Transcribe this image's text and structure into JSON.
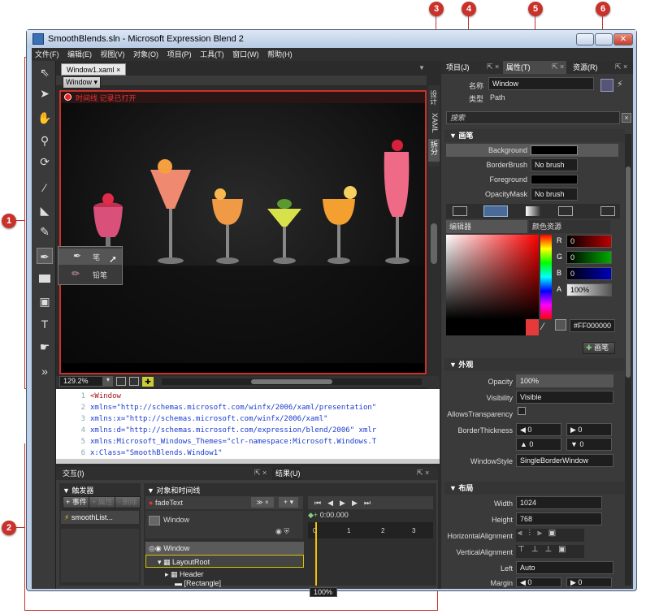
{
  "callouts": [
    "1",
    "2",
    "3",
    "4",
    "5",
    "6"
  ],
  "window": {
    "title": "SmoothBlends.sln - Microsoft Expression Blend 2",
    "menu": [
      "文件(F)",
      "编辑(E)",
      "视图(V)",
      "对象(O)",
      "项目(P)",
      "工具(T)",
      "窗口(W)",
      "帮助(H)"
    ]
  },
  "document": {
    "tab": "Window1.xaml",
    "tab_close": "×",
    "scope": "Window",
    "recording": "时间线 记录已打开",
    "zoom": "129.2%",
    "side_tabs": [
      "设计",
      "XAML",
      "拆分"
    ]
  },
  "tool_flyout": {
    "pen": "笔",
    "pencil": "铅笔"
  },
  "xaml": {
    "lines": [
      {
        "n": "1",
        "text": "<Window"
      },
      {
        "n": "2",
        "text": "    xmlns=\"http://schemas.microsoft.com/winfx/2006/xaml/presentation\""
      },
      {
        "n": "3",
        "text": "    xmlns:x=\"http://schemas.microsoft.com/winfx/2006/xaml\""
      },
      {
        "n": "4",
        "text": "    xmlns:d=\"http://schemas.microsoft.com/expression/blend/2006\" xmlr"
      },
      {
        "n": "5",
        "text": "    xmlns:Microsoft_Windows_Themes=\"clr-namespace:Microsoft.Windows.T"
      },
      {
        "n": "6",
        "text": "    x:Class=\"SmoothBlends.Window1\""
      }
    ]
  },
  "interaction": {
    "tab": "交互(I)",
    "triggers_title": "触发器",
    "add_event": "+ 事件",
    "add_property": "+ 属性",
    "remove": "- 删除",
    "trigger_item": "smoothList...",
    "objects_title": "对象和时间线",
    "storyboard": "fadeText",
    "time": "0:00.000",
    "window_label": "Window",
    "ticks": [
      "0",
      "1",
      "2",
      "3"
    ],
    "tree": [
      "Window",
      "LayoutRoot",
      "Header",
      "[Rectangle]"
    ],
    "zoom": "100%"
  },
  "results_tab": "结果(U)",
  "right_tabs": {
    "project": "项目(J)",
    "properties": "属性(T)",
    "resources": "资源(R)"
  },
  "properties": {
    "name_label": "名称",
    "name_value": "Window",
    "type_label": "类型",
    "type_value": "Path",
    "search": "搜索",
    "brushes_title": "画笔",
    "brushes": [
      {
        "name": "Background",
        "value": ""
      },
      {
        "name": "BorderBrush",
        "value": "No brush"
      },
      {
        "name": "Foreground",
        "value": ""
      },
      {
        "name": "OpacityMask",
        "value": "No brush"
      }
    ],
    "editor_tab": "编辑器",
    "color_res_tab": "颜色资源",
    "rgba": [
      {
        "k": "R",
        "v": "0"
      },
      {
        "k": "G",
        "v": "0"
      },
      {
        "k": "B",
        "v": "0"
      },
      {
        "k": "A",
        "v": "100%"
      }
    ],
    "hex": "#FF000000",
    "brush_btn": "画笔",
    "appearance_title": "外观",
    "appearance": [
      {
        "name": "Opacity",
        "value": "100%"
      },
      {
        "name": "Visibility",
        "value": "Visible"
      },
      {
        "name": "AllowsTransparency",
        "value": ""
      },
      {
        "name": "BorderThickness",
        "value": ""
      },
      {
        "name": "WindowStyle",
        "value": "SingleBorderWindow"
      }
    ],
    "border_vals": [
      "0",
      "0",
      "0",
      "0"
    ],
    "layout_title": "布局",
    "layout": [
      {
        "name": "Width",
        "value": "1024"
      },
      {
        "name": "Height",
        "value": "768"
      },
      {
        "name": "HorizontalAlignment",
        "value": ""
      },
      {
        "name": "VerticalAlignment",
        "value": ""
      },
      {
        "name": "Left",
        "value": "Auto"
      },
      {
        "name": "Margin",
        "value": ""
      }
    ],
    "margin_vals": [
      "0",
      "0"
    ]
  },
  "colors": {
    "accent": "#c8322a",
    "selected_color": "#e63a3a"
  }
}
